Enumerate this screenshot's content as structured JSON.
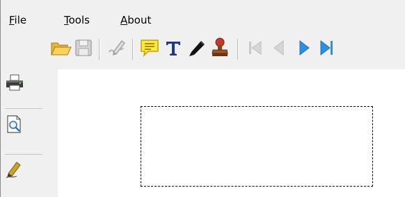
{
  "menu": {
    "file": {
      "mnemonic": "F",
      "rest": "ile"
    },
    "tools": {
      "mnemonic": "T",
      "rest": "ools"
    },
    "about": {
      "mnemonic": "A",
      "rest": "bout"
    }
  },
  "toolbar": {
    "icons": [
      "open-folder-icon",
      "save-icon",
      "signature-pen-icon",
      "comment-icon",
      "text-icon",
      "pen-icon",
      "stamp-icon",
      "first-page-icon",
      "previous-page-icon",
      "next-page-icon",
      "last-page-icon"
    ]
  },
  "sidebar": {
    "icons": [
      "printer-icon",
      "print-preview-icon",
      "sign-icon"
    ]
  },
  "colors": {
    "background": "#f0f0f0",
    "canvas": "#ffffff",
    "comment_yellow": "#ffeb3b",
    "text_tool_blue": "#1f3a8a",
    "stamp_red": "#c0392b",
    "nav_active_blue": "#2e8ee0",
    "nav_disabled_gray": "#c8c8c8"
  }
}
